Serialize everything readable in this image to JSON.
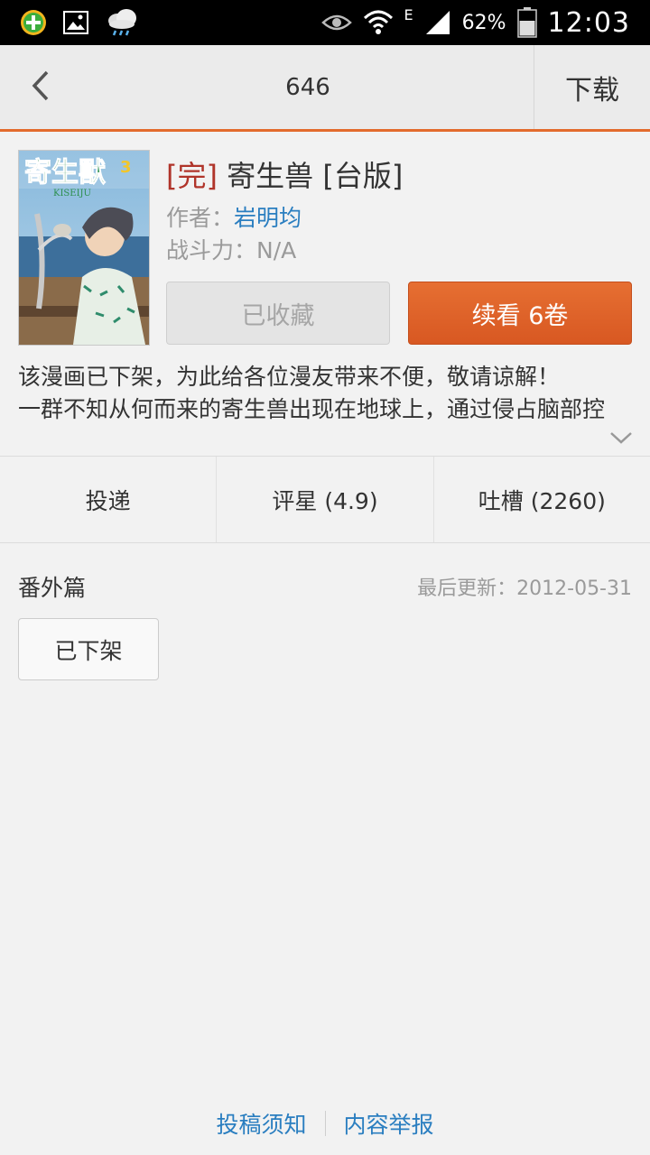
{
  "status_bar": {
    "battery": "62%",
    "time": "12:03",
    "network": "E"
  },
  "header": {
    "title": "646",
    "download_label": "下载"
  },
  "book": {
    "status_tag": "[完]",
    "title": "寄生兽 [台版]",
    "author_label": "作者：",
    "author": "岩明均",
    "power_label": "战斗力：",
    "power": "N/A",
    "cover_title": "寄生獸",
    "cover_volume": "3",
    "cover_subtitle": "KISEIJU",
    "favorite_label": "已收藏",
    "continue_label": "续看 6卷",
    "description": [
      "该漫画已下架，为此给各位漫友带来不便，敬请谅解！",
      "一群不知从何而来的寄生兽出现在地球上，通过侵占脑部控"
    ]
  },
  "actions": [
    {
      "label": "投递"
    },
    {
      "label": "评星 (4.9)"
    },
    {
      "label": "吐槽 (2260)"
    }
  ],
  "section": {
    "title": "番外篇",
    "last_update": "最后更新：2012-05-31",
    "chapters": [
      {
        "label": "已下架"
      }
    ]
  },
  "footer": {
    "submit_guide": "投稿须知",
    "report": "内容举报"
  },
  "colors": {
    "accent": "#e36b2d",
    "link": "#2a7ec0",
    "status_tag": "#b0342a"
  }
}
